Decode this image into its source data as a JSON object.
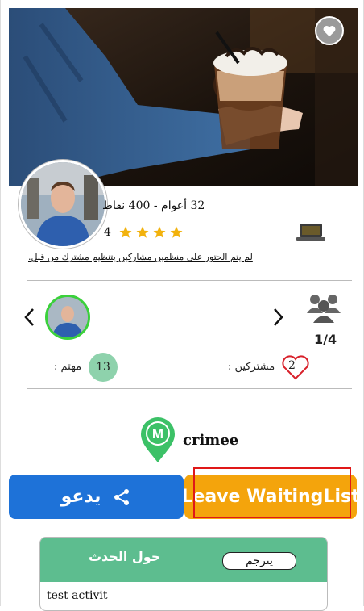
{
  "event": {
    "organizer_meta": "32 أعوام - 400 نقاط",
    "rating": "4",
    "stars_filled": 4,
    "description_note": "لم يتم الحتور على منظمين مشاركين يتنظيم مشترك من قبل.",
    "participants_count": "1/4",
    "interested_label": "مهتم :",
    "interested_count": "13",
    "participants_label": "مشتركين :",
    "participants_value": "2",
    "place_initial": "M",
    "place_name": "crimee"
  },
  "actions": {
    "invite_label": "يدعو",
    "leave_label": "Leave WaitingList"
  },
  "about": {
    "title": "حول الحدث",
    "translate_label": "يترجم",
    "text": "test activit"
  },
  "colors": {
    "invite": "#1e72d8",
    "leave": "#f4a40c",
    "about_header": "#5dbd8f",
    "star": "#f2b20d",
    "pin": "#3cc167",
    "interested_badge": "#8ed2ac"
  },
  "icons": {
    "favorite": "heart-icon",
    "laptop": "laptop-icon",
    "group": "group-icon",
    "share": "share-icon",
    "pin": "map-pin-icon"
  }
}
